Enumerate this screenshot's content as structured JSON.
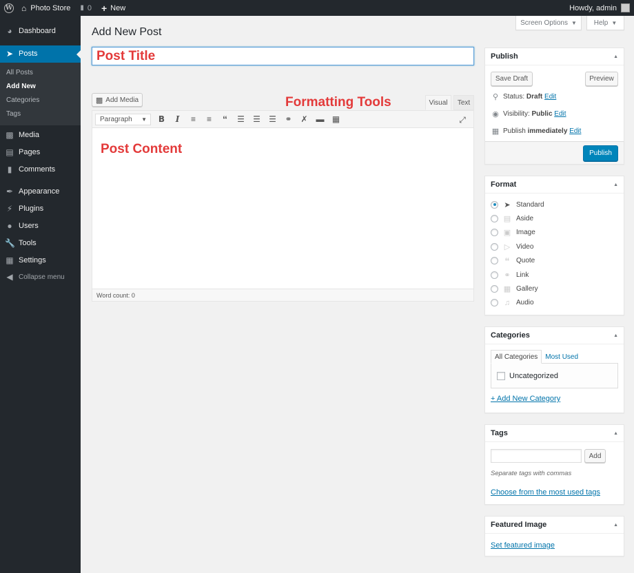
{
  "adminbar": {
    "site_name": "Photo Store",
    "comments_count": "0",
    "new_label": "New",
    "howdy": "Howdy, admin"
  },
  "sidebar": {
    "items": [
      {
        "label": "Dashboard",
        "icon": "dashboard-icon"
      },
      {
        "label": "Posts",
        "icon": "pushpin-icon"
      },
      {
        "label": "Media",
        "icon": "media-icon"
      },
      {
        "label": "Pages",
        "icon": "pages-icon"
      },
      {
        "label": "Comments",
        "icon": "comment-icon"
      },
      {
        "label": "Appearance",
        "icon": "brush-icon"
      },
      {
        "label": "Plugins",
        "icon": "plugin-icon"
      },
      {
        "label": "Users",
        "icon": "users-icon"
      },
      {
        "label": "Tools",
        "icon": "wrench-icon"
      },
      {
        "label": "Settings",
        "icon": "settings-icon"
      },
      {
        "label": "Collapse menu",
        "icon": "collapse-icon"
      }
    ],
    "posts_submenu": [
      "All Posts",
      "Add New",
      "Categories",
      "Tags"
    ]
  },
  "header": {
    "screen_options": "Screen Options",
    "help": "Help",
    "page_title": "Add New Post"
  },
  "editor": {
    "title_annotation": "Post Title",
    "add_media": "Add Media",
    "formatting_annotation": "Formatting Tools",
    "tab_visual": "Visual",
    "tab_text": "Text",
    "paragraph": "Paragraph",
    "content_annotation": "Post Content",
    "word_count": "Word count: 0"
  },
  "publish": {
    "title": "Publish",
    "save_draft": "Save Draft",
    "preview": "Preview",
    "status_label": "Status:",
    "status_value": "Draft",
    "visibility_label": "Visibility:",
    "visibility_value": "Public",
    "publish_label": "Publish",
    "publish_value": "immediately",
    "edit": "Edit",
    "publish_button": "Publish"
  },
  "format": {
    "title": "Format",
    "options": [
      "Standard",
      "Aside",
      "Image",
      "Video",
      "Quote",
      "Link",
      "Gallery",
      "Audio"
    ],
    "selected": "Standard"
  },
  "categories": {
    "title": "Categories",
    "tab_all": "All Categories",
    "tab_most_used": "Most Used",
    "items": [
      "Uncategorized"
    ],
    "add_new": "+ Add New Category"
  },
  "tags": {
    "title": "Tags",
    "add_button": "Add",
    "hint": "Separate tags with commas",
    "choose_link": "Choose from the most used tags"
  },
  "featured_image": {
    "title": "Featured Image",
    "set_link": "Set featured image"
  },
  "colors": {
    "accent": "#0073aa",
    "annotation": "#e33a3a",
    "adminbar": "#23282d"
  }
}
